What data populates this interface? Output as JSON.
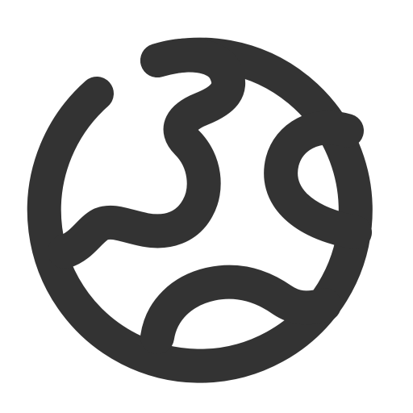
{
  "icon": {
    "name": "earth-globe-icon",
    "stroke_color": "#333333",
    "background_color": "#ffffff"
  }
}
